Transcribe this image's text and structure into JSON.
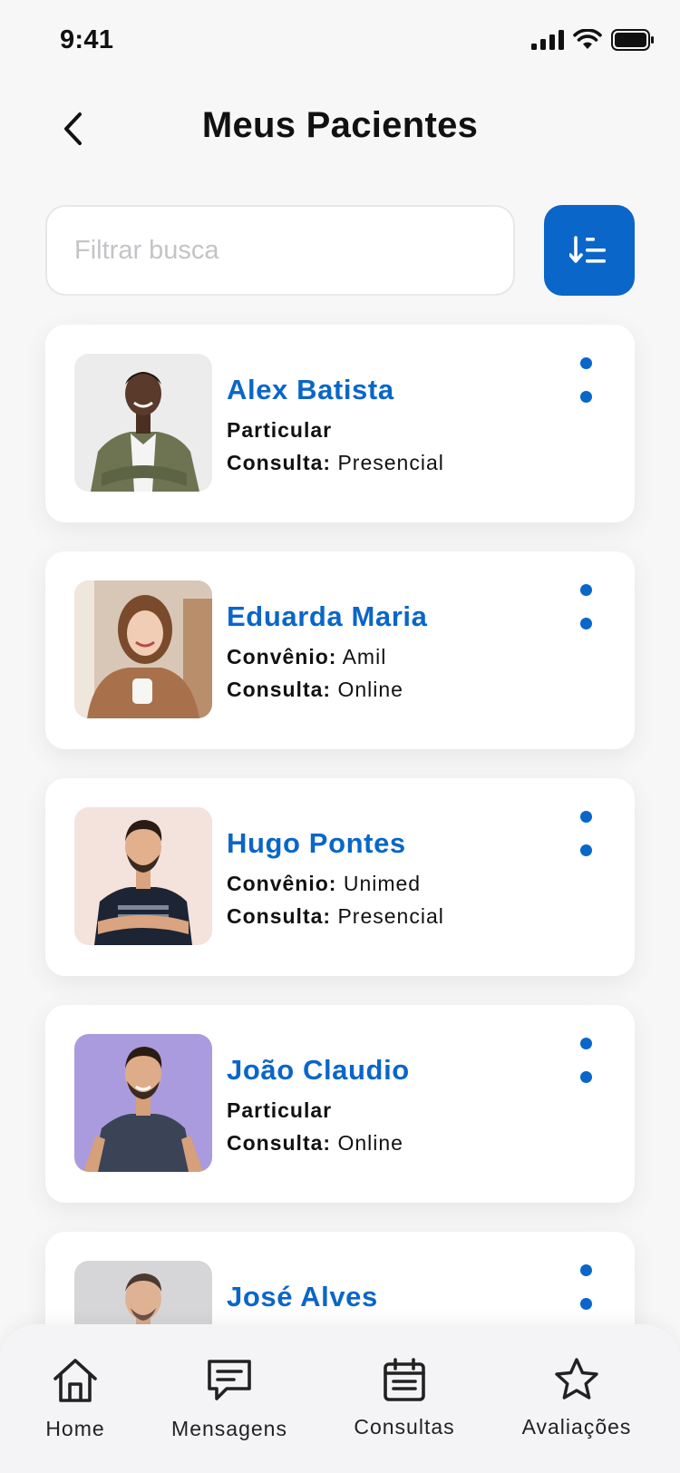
{
  "status_bar": {
    "time": "9:41"
  },
  "header": {
    "title": "Meus Pacientes"
  },
  "search": {
    "placeholder": "Filtrar busca",
    "value": ""
  },
  "patients": [
    {
      "name": "Alex Batista",
      "line1_label": "",
      "line1_value": "Particular",
      "line2_label": "Consulta:",
      "line2_value": "Presencial"
    },
    {
      "name": "Eduarda Maria",
      "line1_label": "Convênio:",
      "line1_value": "Amil",
      "line2_label": "Consulta:",
      "line2_value": "Online"
    },
    {
      "name": "Hugo Pontes",
      "line1_label": "Convênio:",
      "line1_value": "Unimed",
      "line2_label": "Consulta:",
      "line2_value": "Presencial"
    },
    {
      "name": "João Claudio",
      "line1_label": "",
      "line1_value": "Particular",
      "line2_label": "Consulta:",
      "line2_value": "Online"
    },
    {
      "name": "José Alves",
      "line1_label": "",
      "line1_value": "",
      "line2_label": "",
      "line2_value": ""
    }
  ],
  "bottom_nav": {
    "items": [
      {
        "label": "Home",
        "icon": "home-icon"
      },
      {
        "label": "Mensagens",
        "icon": "message-icon"
      },
      {
        "label": "Consultas",
        "icon": "calendar-icon"
      },
      {
        "label": "Avaliações",
        "icon": "star-icon"
      }
    ]
  },
  "colors": {
    "accent": "#0a66c8",
    "background": "#f7f7f8",
    "card": "#ffffff"
  }
}
